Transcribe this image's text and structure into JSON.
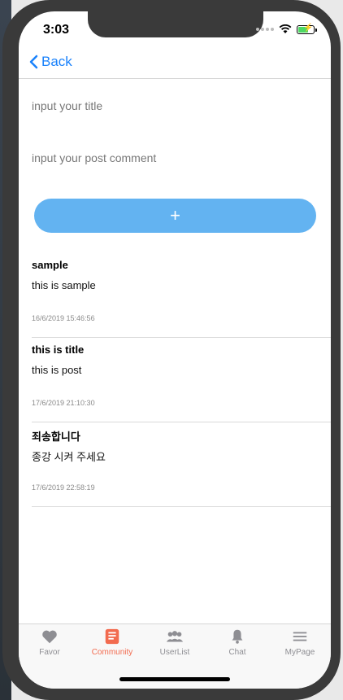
{
  "status": {
    "time": "3:03"
  },
  "nav": {
    "back_label": "Back"
  },
  "form": {
    "title_placeholder": "input your title",
    "comment_placeholder": "input your post comment",
    "add_label": "+"
  },
  "posts": [
    {
      "title": "sample",
      "body": "this is sample",
      "date": "16/6/2019 15:46:56"
    },
    {
      "title": "this is title",
      "body": "this is post",
      "date": "17/6/2019 21:10:30"
    },
    {
      "title": "죄송합니다",
      "body": "종강 시켜 주세요",
      "date": "17/6/2019 22:58:19"
    }
  ],
  "tabs": [
    {
      "label": "Favor",
      "icon": "heart-icon",
      "active": false
    },
    {
      "label": "Community",
      "icon": "community-icon",
      "active": true
    },
    {
      "label": "UserList",
      "icon": "users-icon",
      "active": false
    },
    {
      "label": "Chat",
      "icon": "bell-icon",
      "active": false
    },
    {
      "label": "MyPage",
      "icon": "menu-icon",
      "active": false
    }
  ],
  "colors": {
    "accent": "#1a82fb",
    "button": "#63b3f1",
    "active_tab": "#f26b4f",
    "inactive_tab": "#8e8e93"
  }
}
